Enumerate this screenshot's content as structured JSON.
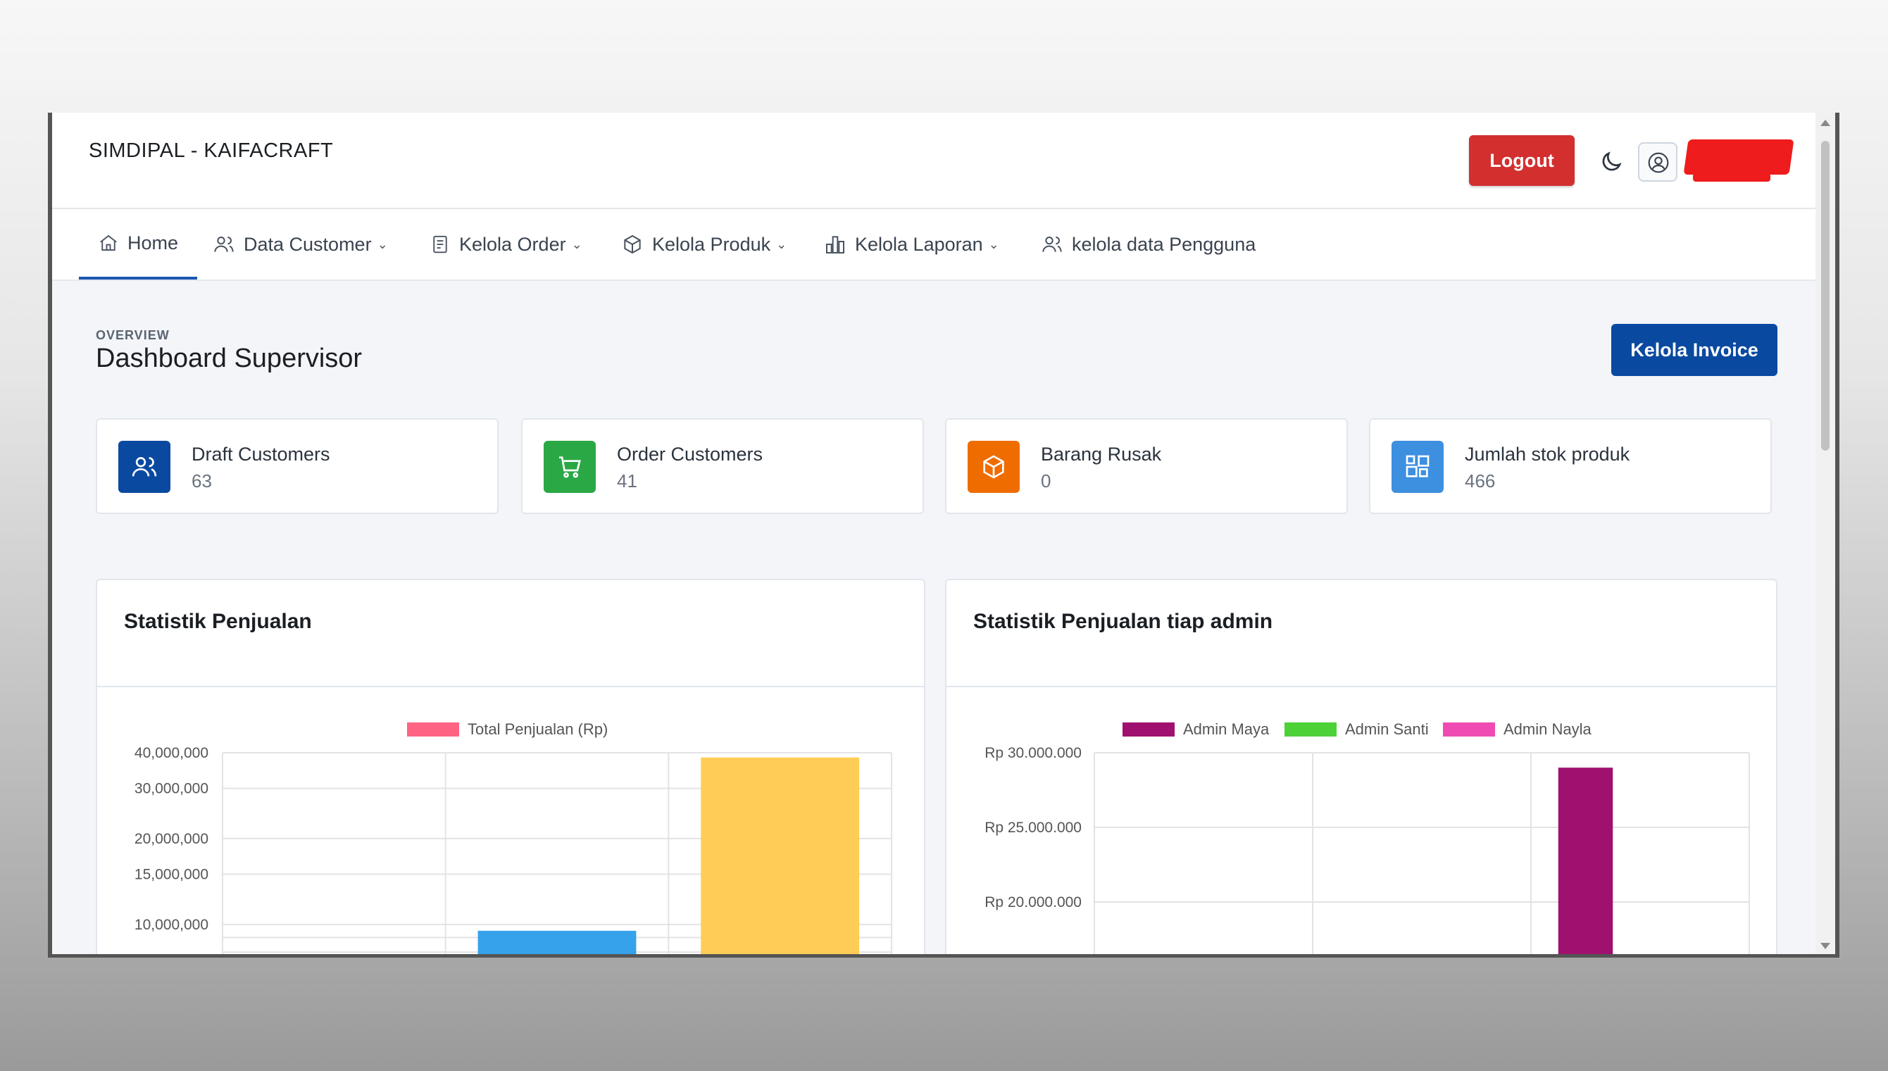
{
  "app": {
    "brand": "SIMDIPAL - KAIFACRAFT",
    "logout_label": "Logout"
  },
  "nav": {
    "items": [
      {
        "label": "Home",
        "icon": "home-icon"
      },
      {
        "label": "Data Customer",
        "icon": "users-icon"
      },
      {
        "label": "Kelola Order",
        "icon": "document-icon"
      },
      {
        "label": "Kelola Produk",
        "icon": "box-icon"
      },
      {
        "label": "Kelola Laporan",
        "icon": "bar-chart-icon"
      },
      {
        "label": "kelola data Pengguna",
        "icon": "users-icon"
      }
    ]
  },
  "page": {
    "overline": "OVERVIEW",
    "title": "Dashboard Supervisor",
    "invoice_label": "Kelola Invoice"
  },
  "stats": [
    {
      "label": "Draft Customers",
      "value": "63",
      "color": "#0a49a0",
      "icon": "users-icon"
    },
    {
      "label": "Order Customers",
      "value": "41",
      "color": "#2aa845",
      "icon": "cart-icon"
    },
    {
      "label": "Barang Rusak",
      "value": "0",
      "color": "#ef6c00",
      "icon": "box-icon"
    },
    {
      "label": "Jumlah stok produk",
      "value": "466",
      "color": "#3d8fe0",
      "icon": "apps-icon"
    }
  ],
  "panels": {
    "left_title": "Statistik Penjualan",
    "right_title": "Statistik Penjualan tiap admin"
  },
  "chart_data": [
    {
      "type": "bar",
      "title": "Statistik Penjualan",
      "categories": [
        "",
        "",
        ""
      ],
      "series": [
        {
          "name": "Total Penjualan (Rp)",
          "values": [
            0,
            9500000,
            38500000
          ]
        }
      ],
      "bar_colors": [
        "#ff6384",
        "#36a2eb",
        "#ffcd56"
      ],
      "legend_color": "#ff6384",
      "yscale": "log",
      "yticks": [
        "40,000,000",
        "30,000,000",
        "20,000,000",
        "15,000,000",
        "10,000,000"
      ],
      "grid": true,
      "legend_position": "top"
    },
    {
      "type": "bar",
      "title": "Statistik Penjualan tiap admin",
      "categories": [
        "",
        "",
        ""
      ],
      "series": [
        {
          "name": "Admin Maya",
          "color": "#a0106f",
          "values": [
            0,
            0,
            29000000
          ]
        },
        {
          "name": "Admin Santi",
          "color": "#4cd137",
          "values": [
            0,
            0,
            0
          ]
        },
        {
          "name": "Admin Nayla",
          "color": "#ef4bb3",
          "values": [
            0,
            0,
            0
          ]
        }
      ],
      "yticks": [
        "Rp 30.000.000",
        "Rp 25.000.000",
        "Rp 20.000.000"
      ],
      "ylim": [
        15000000,
        30000000
      ],
      "grid": true,
      "legend_position": "top"
    }
  ]
}
